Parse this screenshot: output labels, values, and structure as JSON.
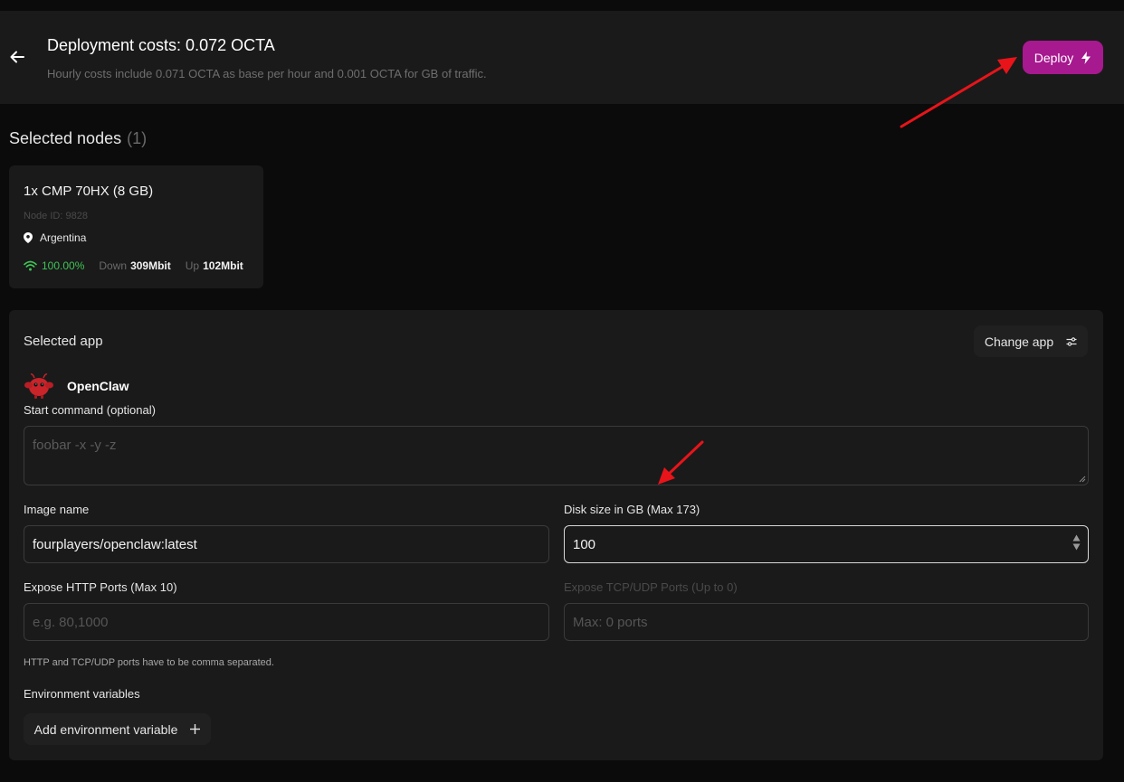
{
  "header": {
    "title": "Deployment costs: 0.072 OCTA",
    "subtitle": "Hourly costs include 0.071 OCTA as base per hour and 0.001 OCTA for GB of traffic.",
    "deploy_label": "Deploy"
  },
  "selected_nodes": {
    "title": "Selected nodes",
    "count": "(1)",
    "node": {
      "name": "1x CMP 70HX (8 GB)",
      "id_text": "Node ID: 9828",
      "location": "Argentina",
      "uptime": "100.00%",
      "down_label": "Down",
      "down_value": "309Mbit",
      "up_label": "Up",
      "up_value": "102Mbit"
    }
  },
  "selected_app": {
    "title": "Selected app",
    "change_label": "Change app",
    "app_name": "OpenClaw",
    "start_command_label": "Start command (optional)",
    "start_command_placeholder": "foobar -x -y -z",
    "image_label": "Image name",
    "image_value": "fourplayers/openclaw:latest",
    "disk_label": "Disk size in GB (Max 173)",
    "disk_value": "100",
    "http_label": "Expose HTTP Ports (Max 10)",
    "http_placeholder": "e.g. 80,1000",
    "tcp_label": "Expose TCP/UDP Ports (Up to 0)",
    "tcp_placeholder": "Max: 0 ports",
    "hint": "HTTP and TCP/UDP ports have to be comma separated.",
    "env_title": "Environment variables",
    "add_env_label": "Add environment variable"
  },
  "colors": {
    "accent": "#a7198f",
    "uptime_green": "#3fc456",
    "annotation_red": "#e8141a"
  }
}
